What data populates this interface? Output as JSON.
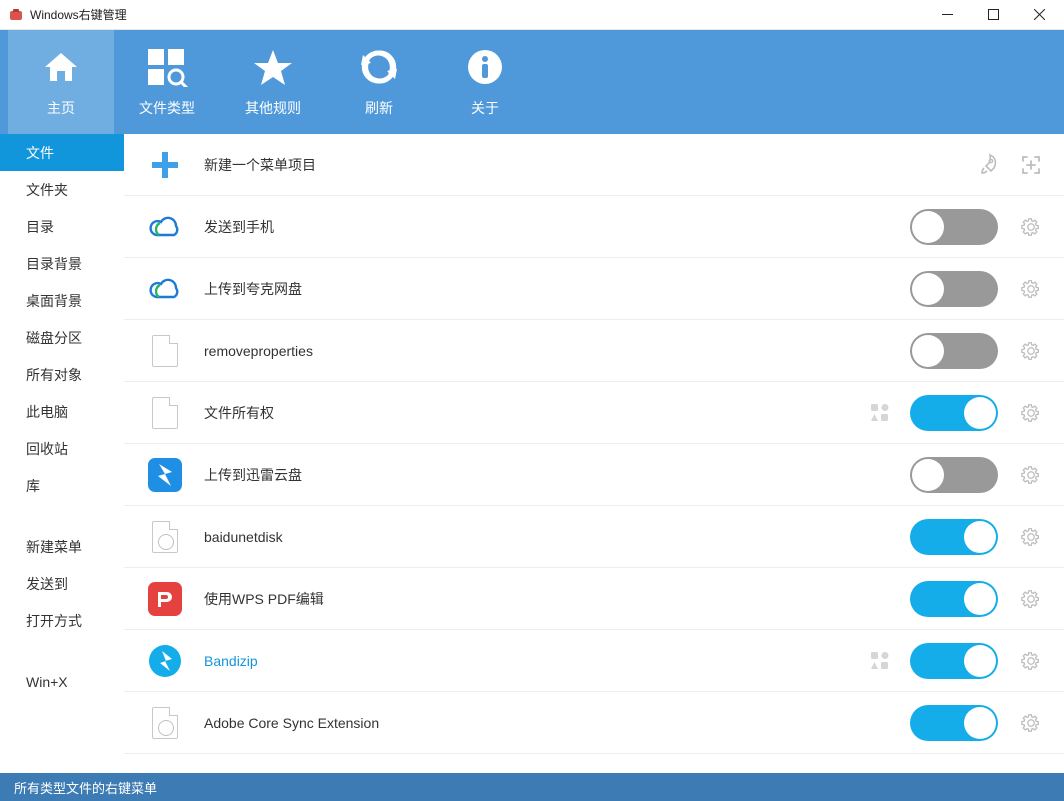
{
  "window": {
    "title": "Windows右键管理"
  },
  "toolbar": [
    {
      "id": "home",
      "label": "主页",
      "selected": true
    },
    {
      "id": "filetypes",
      "label": "文件类型",
      "selected": false
    },
    {
      "id": "other",
      "label": "其他规则",
      "selected": false
    },
    {
      "id": "refresh",
      "label": "刷新",
      "selected": false
    },
    {
      "id": "about",
      "label": "关于",
      "selected": false
    }
  ],
  "sidebar": {
    "group1": [
      {
        "id": "file",
        "label": "文件",
        "selected": true
      },
      {
        "id": "folder",
        "label": "文件夹",
        "selected": false
      },
      {
        "id": "dir",
        "label": "目录",
        "selected": false
      },
      {
        "id": "dirbg",
        "label": "目录背景",
        "selected": false
      },
      {
        "id": "deskbg",
        "label": "桌面背景",
        "selected": false
      },
      {
        "id": "diskpart",
        "label": "磁盘分区",
        "selected": false
      },
      {
        "id": "allobj",
        "label": "所有对象",
        "selected": false
      },
      {
        "id": "thispc",
        "label": "此电脑",
        "selected": false
      },
      {
        "id": "recycle",
        "label": "回收站",
        "selected": false
      },
      {
        "id": "library",
        "label": "库",
        "selected": false
      }
    ],
    "group2": [
      {
        "id": "newmenu",
        "label": "新建菜单"
      },
      {
        "id": "sendto",
        "label": "发送到"
      },
      {
        "id": "openwith",
        "label": "打开方式"
      }
    ],
    "group3": [
      {
        "id": "winx",
        "label": "Win+X"
      }
    ]
  },
  "newItem": {
    "label": "新建一个菜单项目"
  },
  "items": [
    {
      "id": "sendphone",
      "label": "发送到手机",
      "icon": "cloud",
      "enabled": false,
      "tiles": false,
      "blue": false
    },
    {
      "id": "quark",
      "label": "上传到夸克网盘",
      "icon": "cloud",
      "enabled": false,
      "tiles": false,
      "blue": false
    },
    {
      "id": "removeprop",
      "label": "removeproperties",
      "icon": "doc",
      "enabled": false,
      "tiles": false,
      "blue": false
    },
    {
      "id": "fileowner",
      "label": "文件所有权",
      "icon": "doc",
      "enabled": true,
      "tiles": true,
      "blue": false
    },
    {
      "id": "xunlei",
      "label": "上传到迅雷云盘",
      "icon": "xunlei",
      "enabled": false,
      "tiles": false,
      "blue": false
    },
    {
      "id": "baidu",
      "label": "baidunetdisk",
      "icon": "docgear",
      "enabled": true,
      "tiles": false,
      "blue": false
    },
    {
      "id": "wpspdf",
      "label": "使用WPS PDF编辑",
      "icon": "wps",
      "enabled": true,
      "tiles": false,
      "blue": false
    },
    {
      "id": "bandizip",
      "label": "Bandizip",
      "icon": "bandizip",
      "enabled": true,
      "tiles": true,
      "blue": true
    },
    {
      "id": "adobecore",
      "label": "Adobe Core Sync Extension",
      "icon": "docgear",
      "enabled": true,
      "tiles": false,
      "blue": false
    }
  ],
  "status": {
    "text": "所有类型文件的右键菜单"
  }
}
